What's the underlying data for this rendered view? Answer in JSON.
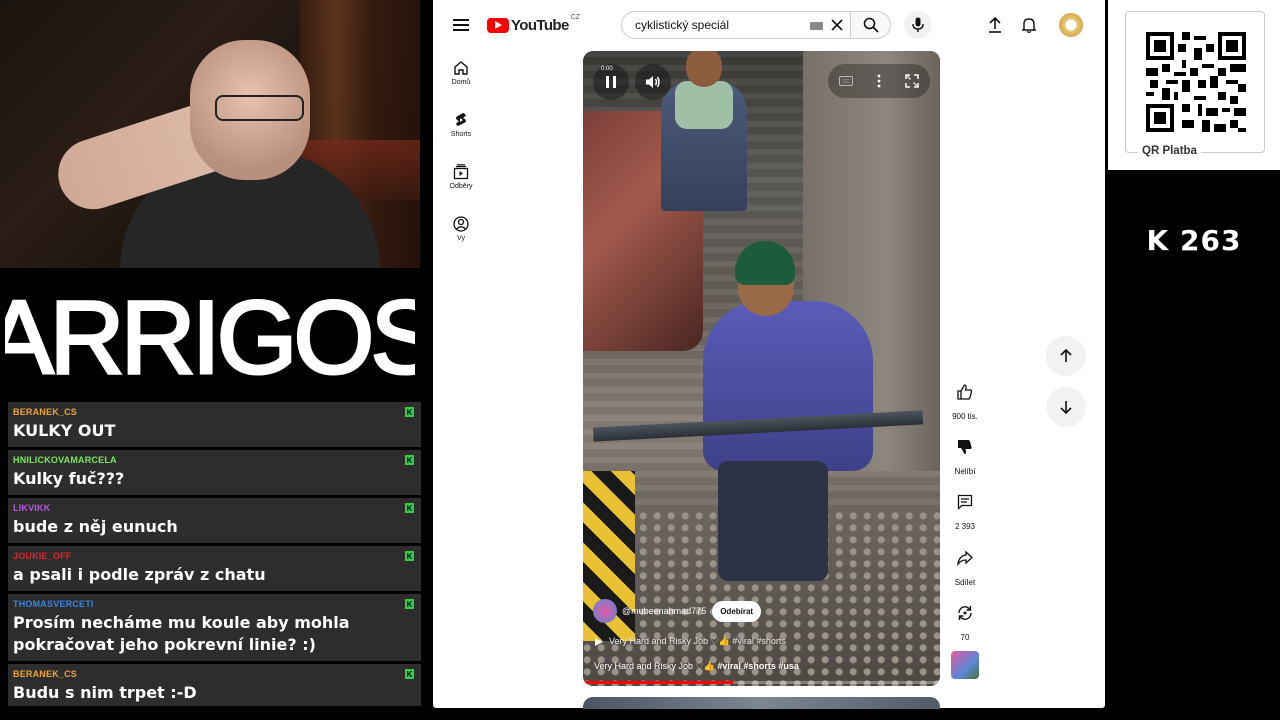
{
  "brand": "ARRIGOS",
  "chat": [
    {
      "user": "BERANEK_CS",
      "color": "#f0a53a",
      "text": "KULKY OUT"
    },
    {
      "user": "HNILICKOVAMARCELA",
      "color": "#7be85c",
      "text": "Kulky fuč???"
    },
    {
      "user": "LIKVIKK",
      "color": "#b25bd6",
      "text": "bude z něj eunuch"
    },
    {
      "user": "JOUKIE_OFF",
      "color": "#d8262f",
      "text": "a psali i podle zpráv z chatu"
    },
    {
      "user": "THOMASVERCETI",
      "color": "#3a83e0",
      "text": "Prosím necháme mu koule aby mohla pokračovat jeho pokrevní linie? :)"
    },
    {
      "user": "BERANEK_CS",
      "color": "#f0a53a",
      "text": "Budu s nim trpet :-D"
    }
  ],
  "youtube": {
    "logo_text": "YouTube",
    "region": "CZ",
    "search_value": "cyklistický speciál",
    "sidebar": [
      "Domů",
      "Shorts",
      "Odběry",
      "Vy"
    ],
    "video": {
      "time": "0:00",
      "channel": "@mubeenahmad775",
      "subscribe": "Odebírat",
      "suggestion": "Very Hard and Risky Job ♡👍 #viral #shorts",
      "title_plain": "Very Hard and Risky Job ♡👍",
      "title_tags": "#viral #shorts #usa",
      "progress": 0.42
    },
    "actions": {
      "likes": "900 tis.",
      "dislike": "Nelíbí",
      "comments": "2 393",
      "share": "Sdílet",
      "remix": "70"
    }
  },
  "qr": {
    "label": "QR Platba"
  },
  "counter": "K 263"
}
